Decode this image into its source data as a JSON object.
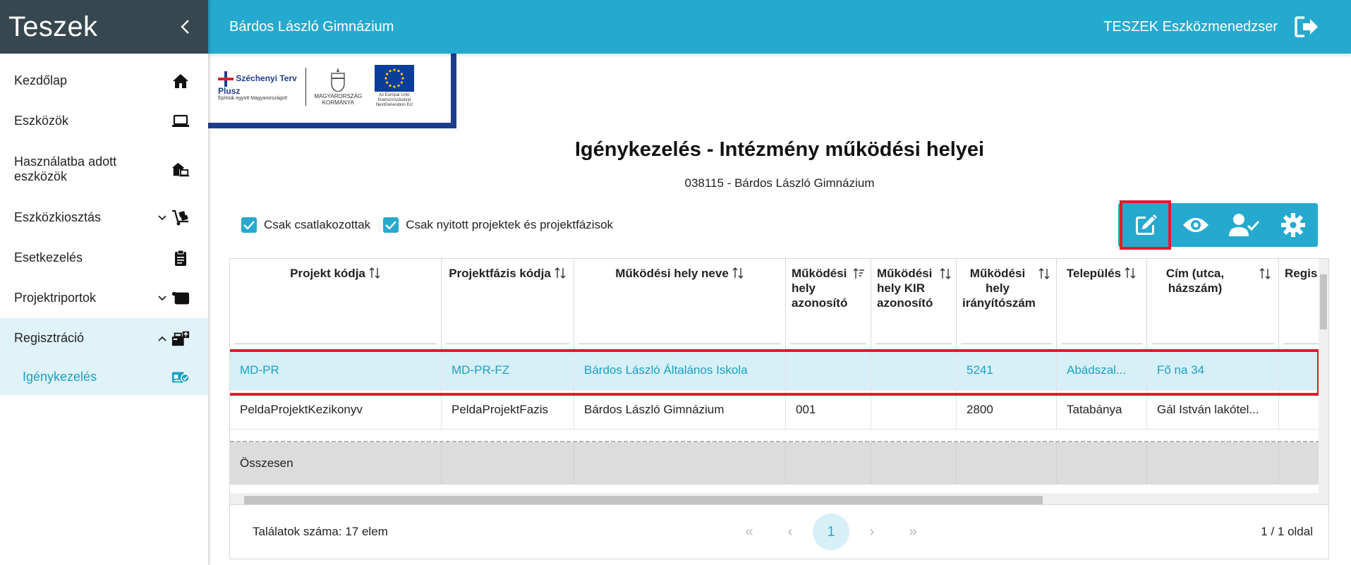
{
  "app": {
    "title": "Teszek"
  },
  "header": {
    "school": "Bárdos László Gimnázium",
    "app_name": "TESZEK Eszközmenedzser"
  },
  "sidebar": {
    "items": [
      {
        "label": "Kezdőlap"
      },
      {
        "label": "Eszközök"
      },
      {
        "label": "Használatba adott eszközök"
      },
      {
        "label": "Eszközkiosztás"
      },
      {
        "label": "Esetkezelés"
      },
      {
        "label": "Projektriportok"
      },
      {
        "label": "Regisztráció"
      }
    ],
    "sub_item": {
      "label": "Igénykezelés"
    }
  },
  "banner": {
    "program_line1": "Széchenyi Terv",
    "program_line2": "Plusz",
    "program_tag": "Építsük együtt Magyarországot!",
    "gov": "MAGYARORSZÁG KORMÁNYA",
    "eu": "Az Európai Unió finanszírozásával NextGeneration EU"
  },
  "page": {
    "title": "Igénykezelés - Intézmény működési helyei",
    "subtitle": "038115 - Bárdos László Gimnázium"
  },
  "filters": {
    "connected_only": "Csak csatlakozottak",
    "open_projects_only": "Csak nyitott projektek és projektfázisok"
  },
  "table": {
    "columns": [
      "Projekt kódja",
      "Projektfázis kódja",
      "Működési hely neve",
      "Működési hely azonosító",
      "Működési hely KIR azonosító",
      "Működési hely irányítószám",
      "Település",
      "Cím (utca, házszám)",
      "Regis össz"
    ],
    "rows": [
      [
        "MD-PR",
        "MD-PR-FZ",
        "Bárdos László Általános Iskola",
        "",
        "",
        "5241",
        "Abádszal...",
        "Fő na 34",
        ""
      ],
      [
        "PeldaProjektKezikonyv",
        "PeldaProjektFazis",
        "Bárdos László Gimnázium",
        "001",
        "",
        "2800",
        "Tatabánya",
        "Gál István lakótel...",
        ""
      ]
    ],
    "total_label": "Összesen"
  },
  "pager": {
    "results": "Találatok száma: 17 elem",
    "first": "«",
    "prev": "‹",
    "current": "1",
    "next": "›",
    "last": "»",
    "page_of": "1 / 1 oldal"
  },
  "colors": {
    "accent": "#26a9ce",
    "sidebar_dark": "#37474f",
    "highlight": "#e21b2b"
  }
}
